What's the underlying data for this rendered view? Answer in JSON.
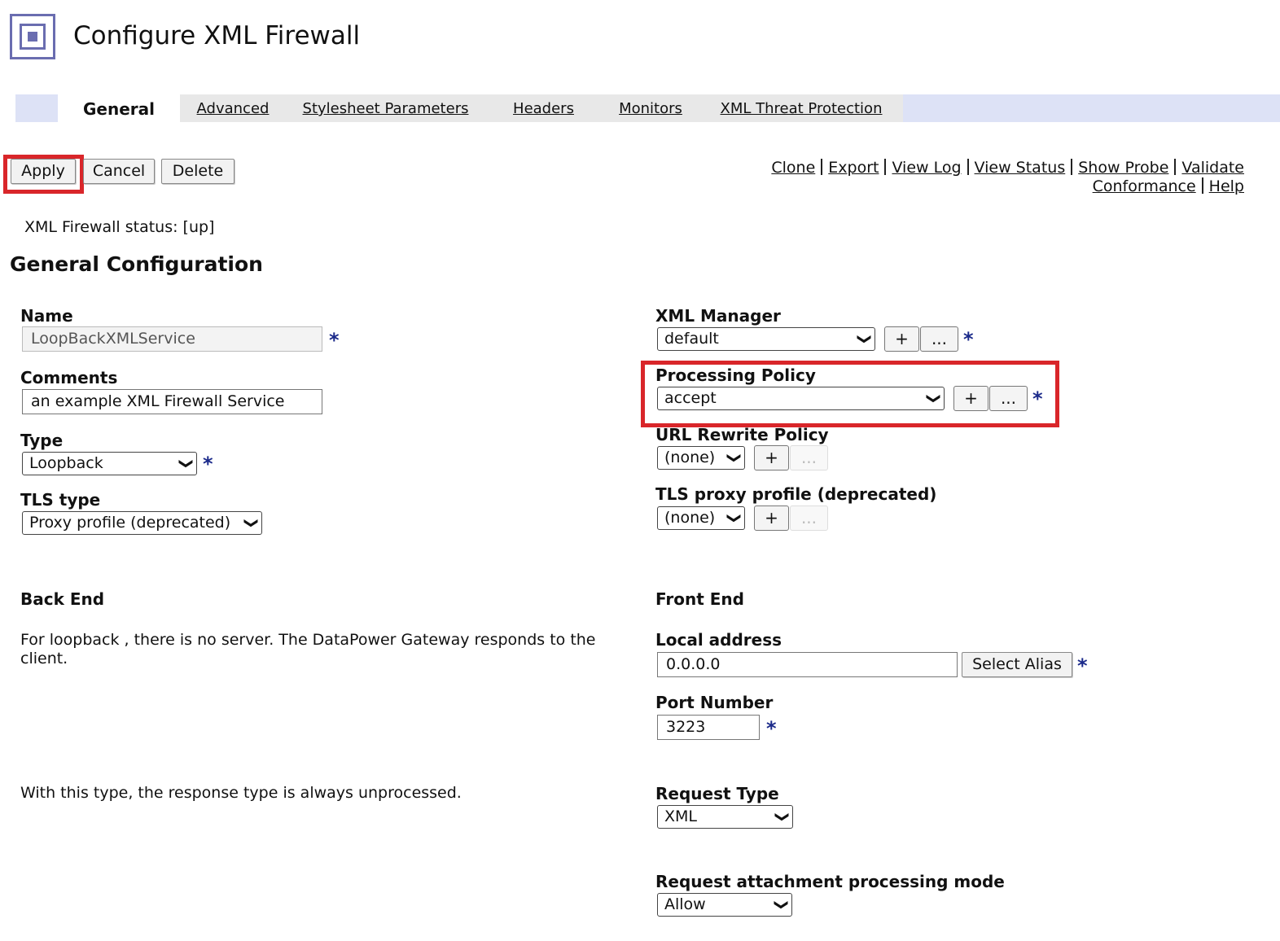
{
  "header": {
    "title": "Configure XML Firewall"
  },
  "tabs": [
    {
      "label": "General",
      "active": true
    },
    {
      "label": "Advanced"
    },
    {
      "label": "Stylesheet Parameters"
    },
    {
      "label": "Headers"
    },
    {
      "label": "Monitors"
    },
    {
      "label": "XML Threat Protection"
    }
  ],
  "toolbar": {
    "apply": "Apply",
    "cancel": "Cancel",
    "delete": "Delete"
  },
  "links": {
    "clone": "Clone",
    "export": "Export",
    "view_log": "View Log",
    "view_status": "View Status",
    "show_probe": "Show Probe",
    "validate": "Validate",
    "conformance": "Conformance",
    "help": "Help"
  },
  "status": "XML Firewall status: [up]",
  "section_title": "General Configuration",
  "left": {
    "name": {
      "label": "Name",
      "value": "LoopBackXMLService"
    },
    "comments": {
      "label": "Comments",
      "value": "an example XML Firewall Service"
    },
    "type": {
      "label": "Type",
      "value": "Loopback"
    },
    "tls_type": {
      "label": "TLS type",
      "value": "Proxy profile (deprecated)"
    },
    "back_end": {
      "label": "Back End",
      "description": "For loopback , there is no server. The DataPower Gateway responds to the client."
    },
    "response_note": "With this type, the response type is always unprocessed."
  },
  "right": {
    "xml_manager": {
      "label": "XML Manager",
      "value": "default"
    },
    "processing_policy": {
      "label": "Processing Policy",
      "value": "accept"
    },
    "url_rewrite": {
      "label": "URL Rewrite Policy",
      "value": "(none)"
    },
    "tls_proxy": {
      "label": "TLS proxy profile (deprecated)",
      "value": "(none)"
    },
    "front_end": {
      "label": "Front End"
    },
    "local_address": {
      "label": "Local address",
      "value": "0.0.0.0",
      "button": "Select Alias"
    },
    "port_number": {
      "label": "Port Number",
      "value": "3223"
    },
    "request_type": {
      "label": "Request Type",
      "value": "XML"
    },
    "attachment_mode": {
      "label": "Request attachment processing mode",
      "value": "Allow"
    }
  },
  "symbols": {
    "required": "*",
    "add": "+",
    "edit": "..."
  },
  "colors": {
    "highlight": "#d9262a",
    "accent": "#6a6db0",
    "required": "#1b2a8a",
    "tabbar": "#dde2f6"
  }
}
